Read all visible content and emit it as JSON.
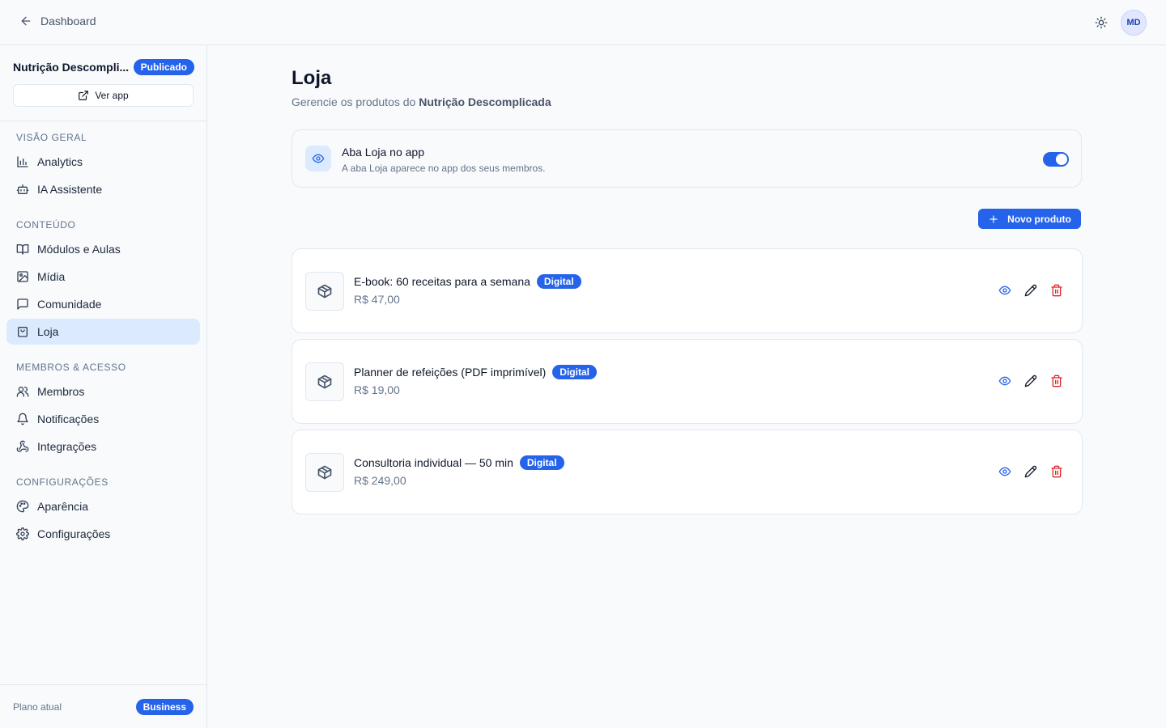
{
  "topbar": {
    "back_label": "Dashboard",
    "avatar_initials": "MD"
  },
  "sidebar": {
    "project_name": "Nutrição Descompli...",
    "status_badge": "Publicado",
    "view_app_label": "Ver app",
    "sections": [
      {
        "title": "VISÃO GERAL",
        "items": [
          {
            "label": "Analytics",
            "icon": "bar-chart-icon"
          },
          {
            "label": "IA Assistente",
            "icon": "bot-icon"
          }
        ]
      },
      {
        "title": "CONTEÚDO",
        "items": [
          {
            "label": "Módulos e Aulas",
            "icon": "book-open-icon"
          },
          {
            "label": "Mídia",
            "icon": "image-icon"
          },
          {
            "label": "Comunidade",
            "icon": "message-square-icon"
          },
          {
            "label": "Loja",
            "icon": "shopping-bag-icon",
            "active": true
          }
        ]
      },
      {
        "title": "MEMBROS & ACESSO",
        "items": [
          {
            "label": "Membros",
            "icon": "users-icon"
          },
          {
            "label": "Notificações",
            "icon": "bell-icon"
          },
          {
            "label": "Integrações",
            "icon": "webhook-icon"
          }
        ]
      },
      {
        "title": "CONFIGURAÇÕES",
        "items": [
          {
            "label": "Aparência",
            "icon": "palette-icon"
          },
          {
            "label": "Configurações",
            "icon": "settings-icon"
          }
        ]
      }
    ],
    "plan_label": "Plano atual",
    "plan_badge": "Business"
  },
  "main": {
    "title": "Loja",
    "subtitle_prefix": "Gerencie os produtos do ",
    "subtitle_project": "Nutrição Descomplicada",
    "store_tab": {
      "title": "Aba Loja no app",
      "description": "A aba Loja aparece no app dos seus membros.",
      "enabled": true
    },
    "new_product_label": "Novo produto",
    "products": [
      {
        "name": "E-book: 60 receitas para a semana",
        "badge": "Digital",
        "price": "R$ 47,00"
      },
      {
        "name": "Planner de refeições (PDF imprimível)",
        "badge": "Digital",
        "price": "R$ 19,00"
      },
      {
        "name": "Consultoria individual — 50 min",
        "badge": "Digital",
        "price": "R$ 249,00"
      }
    ]
  },
  "colors": {
    "accent": "#2563eb",
    "active_nav_bg": "#dbeafe",
    "danger": "#dc2626"
  }
}
